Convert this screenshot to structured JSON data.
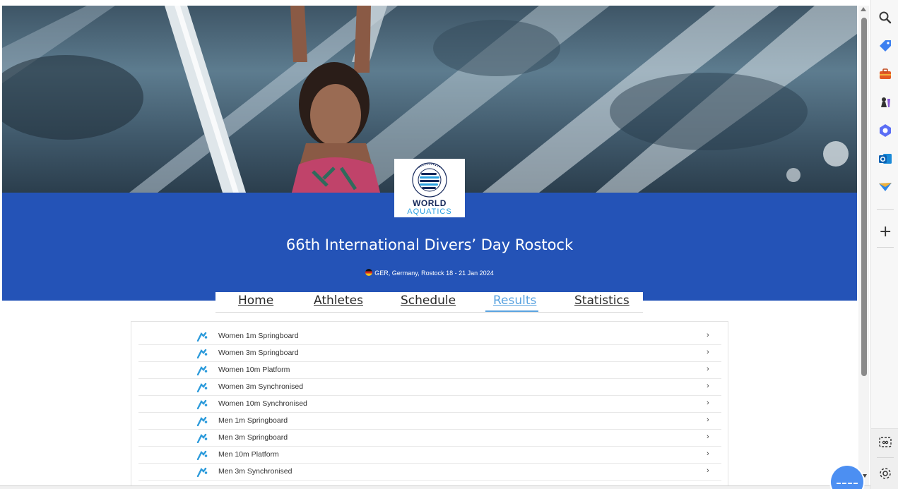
{
  "event": {
    "title": "66th International Divers’ Day Rostock",
    "subtitle": "GER, Germany, Rostock 18 - 21 Jan 2024"
  },
  "logo": {
    "ring_text": "RECOGNISED BY",
    "word1": "WORLD",
    "word2": "AQUATICS"
  },
  "tabs": [
    {
      "label": "Home"
    },
    {
      "label": "Athletes"
    },
    {
      "label": "Schedule"
    },
    {
      "label": "Results",
      "active": true
    },
    {
      "label": "Statistics"
    }
  ],
  "results": [
    {
      "label": "Women 1m Springboard",
      "icon": "diving-icon"
    },
    {
      "label": "Women 3m Springboard",
      "icon": "diving-icon"
    },
    {
      "label": "Women 10m Platform",
      "icon": "diving-icon"
    },
    {
      "label": "Women 3m Synchronised",
      "icon": "diving-icon"
    },
    {
      "label": "Women 10m Synchronised",
      "icon": "diving-icon"
    },
    {
      "label": "Men 1m Springboard",
      "icon": "diving-icon"
    },
    {
      "label": "Men 3m Springboard",
      "icon": "diving-icon"
    },
    {
      "label": "Men 10m Platform",
      "icon": "diving-icon"
    },
    {
      "label": "Men 3m Synchronised",
      "icon": "diving-icon"
    }
  ],
  "row_arrow": "›",
  "sidebar": {
    "icons": [
      "search-icon",
      "tag-icon",
      "briefcase-icon",
      "chess-icon",
      "copilot-icon",
      "outlook-icon",
      "send-icon"
    ],
    "plus_label": "+"
  },
  "colors": {
    "banner": "#2453b7",
    "active_tab": "#5aa3e0",
    "event_icon": "#2d9bdb"
  }
}
